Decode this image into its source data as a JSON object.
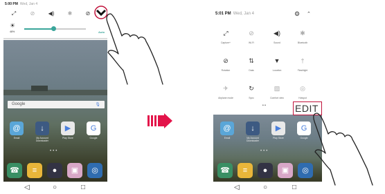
{
  "left": {
    "status": {
      "time": "5:00 PM",
      "date": "Wed, Jan 4"
    },
    "qs_icons": [
      "shrink-icon",
      "wifi-icon",
      "volume-icon",
      "bluetooth-icon",
      "rotation-icon"
    ],
    "brightness": {
      "percent": "48%",
      "auto_label": "Auto",
      "level": 0.48
    },
    "search": {
      "logo": "Google"
    },
    "apps": [
      {
        "label": "Email",
        "icon": "@",
        "color": "#5aa6d8"
      },
      {
        "label": "My Account Downloader",
        "icon": "↓",
        "color": "#3d5a82"
      },
      {
        "label": "Play Store",
        "icon": "▶",
        "color": "#e9e9e9"
      },
      {
        "label": "Google",
        "icon": "G",
        "color": "#ffffff"
      }
    ],
    "dock": [
      "☎",
      "≡",
      "●",
      "▣",
      "◎"
    ],
    "dock_colors": [
      "#3a8f64",
      "#e9b63a",
      "#333344",
      "#d8a7c7",
      "#2f6cb0"
    ],
    "nav": [
      "◁",
      "○",
      "□"
    ]
  },
  "arrow": {
    "symbol": "➡"
  },
  "right": {
    "status": {
      "time": "5:01 PM",
      "date": "Wed, Jan 4"
    },
    "tiles": [
      {
        "label": "Capture+",
        "icon": "⤢",
        "active": true
      },
      {
        "label": "Wi-Fi",
        "icon": "⊘",
        "active": false
      },
      {
        "label": "Sound",
        "icon": "◀)",
        "active": true
      },
      {
        "label": "Bluetooth",
        "icon": "✱",
        "active": false
      },
      {
        "label": "Rotation",
        "icon": "⊘",
        "active": true
      },
      {
        "label": "Data",
        "icon": "⇅",
        "active": true
      },
      {
        "label": "Location",
        "icon": "▼",
        "active": true
      },
      {
        "label": "Flashlight",
        "icon": "†",
        "active": false
      },
      {
        "label": "Airplane mode",
        "icon": "✈",
        "active": false
      },
      {
        "label": "Sync",
        "icon": "↻",
        "active": true
      },
      {
        "label": "Comfort view",
        "icon": "▨",
        "active": false
      },
      {
        "label": "Hotspot",
        "icon": "◎",
        "active": false
      }
    ],
    "page_dots": "• •",
    "edit_label": "EDIT",
    "apps": [
      {
        "label": "Email",
        "icon": "@",
        "color": "#5aa6d8"
      },
      {
        "label": "My Account Downloader",
        "icon": "↓",
        "color": "#3d5a82"
      },
      {
        "label": "Play Store",
        "icon": "▶",
        "color": "#e9e9e9"
      },
      {
        "label": "Google",
        "icon": "G",
        "color": "#ffffff"
      }
    ],
    "dock": [
      "☎",
      "≡",
      "●",
      "▣",
      "◎"
    ],
    "dock_colors": [
      "#3a8f64",
      "#e9b63a",
      "#333344",
      "#d8a7c7",
      "#2f6cb0"
    ],
    "nav": [
      "◁",
      "○",
      "□"
    ]
  },
  "colors": {
    "accent": "#c0123a",
    "slider": "#3aa59a",
    "arrow": "#e3144a"
  }
}
